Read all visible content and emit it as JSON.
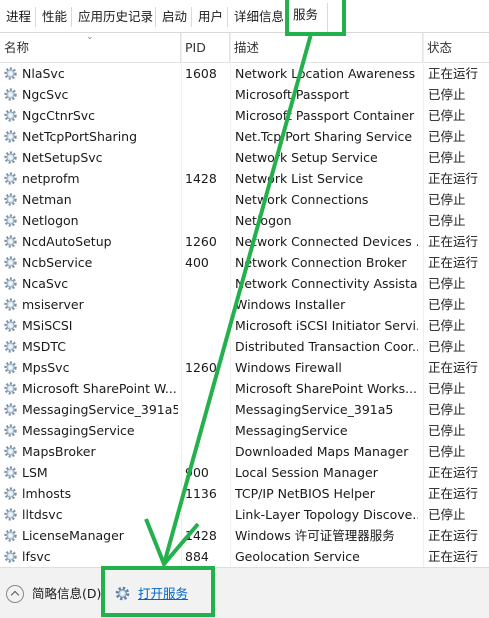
{
  "tabs": [
    "进程",
    "性能",
    "应用历史记录",
    "启动",
    "用户",
    "详细信息",
    "服务"
  ],
  "active_tab": "服务",
  "columns": {
    "name": "名称",
    "pid": "PID",
    "desc": "描述",
    "status": "状态"
  },
  "rows": [
    {
      "name": "NlaSvc",
      "pid": "1608",
      "desc": "Network Location Awareness",
      "status": "正在运行"
    },
    {
      "name": "NgcSvc",
      "pid": "",
      "desc": "Microsoft Passport",
      "status": "已停止"
    },
    {
      "name": "NgcCtnrSvc",
      "pid": "",
      "desc": "Microsoft Passport Container",
      "status": "已停止"
    },
    {
      "name": "NetTcpPortSharing",
      "pid": "",
      "desc": "Net.Tcp Port Sharing Service",
      "status": "已停止"
    },
    {
      "name": "NetSetupSvc",
      "pid": "",
      "desc": "Network Setup Service",
      "status": "已停止"
    },
    {
      "name": "netprofm",
      "pid": "1428",
      "desc": "Network List Service",
      "status": "正在运行"
    },
    {
      "name": "Netman",
      "pid": "",
      "desc": "Network Connections",
      "status": "已停止"
    },
    {
      "name": "Netlogon",
      "pid": "",
      "desc": "Netlogon",
      "status": "已停止"
    },
    {
      "name": "NcdAutoSetup",
      "pid": "1260",
      "desc": "Network Connected Devices ...",
      "status": "正在运行"
    },
    {
      "name": "NcbService",
      "pid": "400",
      "desc": "Network Connection Broker",
      "status": "正在运行"
    },
    {
      "name": "NcaSvc",
      "pid": "",
      "desc": "Network Connectivity Assistant",
      "status": "已停止"
    },
    {
      "name": "msiserver",
      "pid": "",
      "desc": "Windows Installer",
      "status": "已停止"
    },
    {
      "name": "MSiSCSI",
      "pid": "",
      "desc": "Microsoft iSCSI Initiator Servi...",
      "status": "已停止"
    },
    {
      "name": "MSDTC",
      "pid": "",
      "desc": "Distributed Transaction Coor...",
      "status": "已停止"
    },
    {
      "name": "MpsSvc",
      "pid": "1260",
      "desc": "Windows Firewall",
      "status": "正在运行"
    },
    {
      "name": "Microsoft SharePoint W...",
      "pid": "",
      "desc": "Microsoft SharePoint Works...",
      "status": "已停止"
    },
    {
      "name": "MessagingService_391a5",
      "pid": "",
      "desc": "MessagingService_391a5",
      "status": "已停止"
    },
    {
      "name": "MessagingService",
      "pid": "",
      "desc": "MessagingService",
      "status": "已停止"
    },
    {
      "name": "MapsBroker",
      "pid": "",
      "desc": "Downloaded Maps Manager",
      "status": "已停止"
    },
    {
      "name": "LSM",
      "pid": "900",
      "desc": "Local Session Manager",
      "status": "正在运行"
    },
    {
      "name": "lmhosts",
      "pid": "1136",
      "desc": "TCP/IP NetBIOS Helper",
      "status": "正在运行"
    },
    {
      "name": "lltdsvc",
      "pid": "",
      "desc": "Link-Layer Topology Discove...",
      "status": "已停止"
    },
    {
      "name": "LicenseManager",
      "pid": "1428",
      "desc": "Windows 许可证管理器服务",
      "status": "正在运行"
    },
    {
      "name": "lfsvc",
      "pid": "884",
      "desc": "Geolocation Service",
      "status": "正在运行"
    }
  ],
  "footer": {
    "brief_label": "简略信息(D)",
    "open_services_label": "打开服务"
  },
  "icons": {
    "service": "gear-icon",
    "open_services": "gear-icon",
    "collapse": "chevron-up-icon"
  },
  "colors": {
    "annotation": "#22b14c",
    "link": "#0066cc",
    "footer_bg": "#f2f2f2"
  }
}
